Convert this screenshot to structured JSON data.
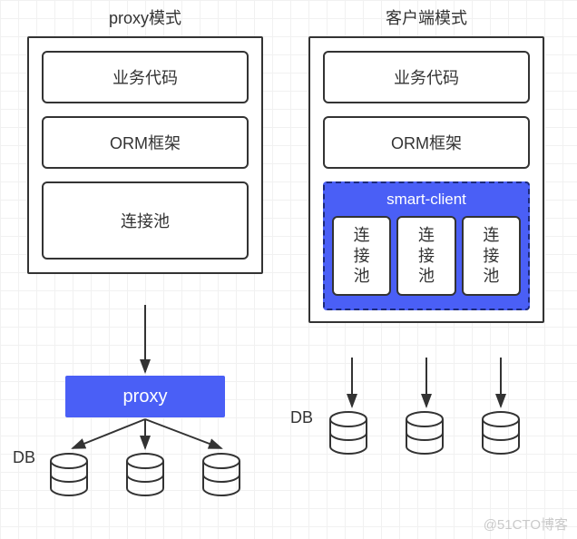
{
  "left": {
    "title": "proxy模式",
    "boxes": [
      "业务代码",
      "ORM框架",
      "连接池"
    ],
    "proxy": "proxy",
    "db_label": "DB"
  },
  "right": {
    "title": "客户端模式",
    "boxes": [
      "业务代码",
      "ORM框架"
    ],
    "smart_client_title": "smart-client",
    "pools": [
      "连接池",
      "连接池",
      "连接池"
    ],
    "db_label": "DB"
  },
  "watermark": "@51CTO博客"
}
